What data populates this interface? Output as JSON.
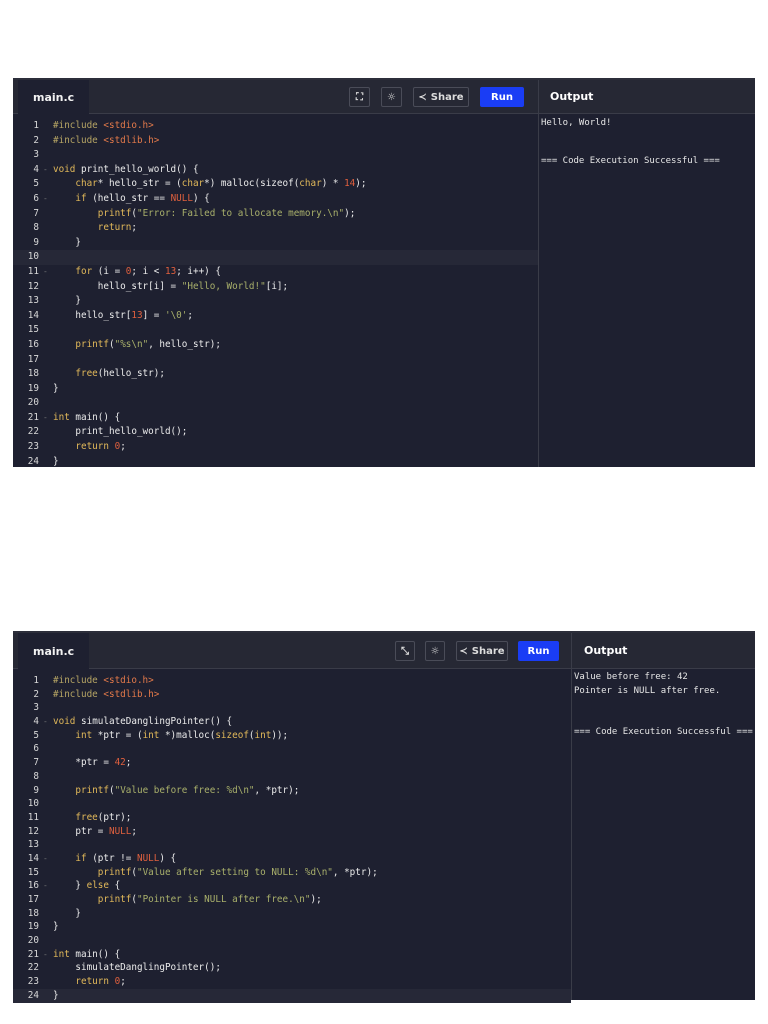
{
  "panels": [
    {
      "tab": "main.c",
      "share_label": "Share",
      "run_label": "Run",
      "output_label": "Output",
      "highlight_line": 10,
      "output": [
        "Hello, World!",
        "",
        "",
        "=== Code Execution Successful ==="
      ],
      "lines": [
        {
          "fold": false,
          "tokens": [
            [
              "p",
              "#include "
            ],
            [
              "h",
              "<stdio.h>"
            ]
          ]
        },
        {
          "fold": false,
          "tokens": [
            [
              "p",
              "#include "
            ],
            [
              "h",
              "<stdlib.h>"
            ]
          ]
        },
        {
          "fold": false,
          "tokens": []
        },
        {
          "fold": true,
          "tokens": [
            [
              "k",
              "void "
            ],
            [
              "t",
              "print_hello_world() {"
            ]
          ]
        },
        {
          "fold": false,
          "tokens": [
            [
              "t",
              "    "
            ],
            [
              "k",
              "char"
            ],
            [
              "t",
              "* hello_str = ("
            ],
            [
              "k",
              "char"
            ],
            [
              "t",
              "*) malloc(sizeof("
            ],
            [
              "k",
              "char"
            ],
            [
              "t",
              ") * "
            ],
            [
              "n",
              "14"
            ],
            [
              "t",
              ");"
            ]
          ]
        },
        {
          "fold": true,
          "tokens": [
            [
              "t",
              "    "
            ],
            [
              "k",
              "if"
            ],
            [
              "t",
              " (hello_str == "
            ],
            [
              "n",
              "NULL"
            ],
            [
              "t",
              ") {"
            ]
          ]
        },
        {
          "fold": false,
          "tokens": [
            [
              "t",
              "        "
            ],
            [
              "k",
              "printf"
            ],
            [
              "t",
              "("
            ],
            [
              "s",
              "\"Error: Failed to allocate memory.\\n\""
            ],
            [
              "t",
              ");"
            ]
          ]
        },
        {
          "fold": false,
          "tokens": [
            [
              "t",
              "        "
            ],
            [
              "k",
              "return"
            ],
            [
              "t",
              ";"
            ]
          ]
        },
        {
          "fold": false,
          "tokens": [
            [
              "t",
              "    }"
            ]
          ]
        },
        {
          "fold": false,
          "tokens": []
        },
        {
          "fold": true,
          "tokens": [
            [
              "t",
              "    "
            ],
            [
              "k",
              "for"
            ],
            [
              "t",
              " (i = "
            ],
            [
              "n",
              "0"
            ],
            [
              "t",
              "; i < "
            ],
            [
              "n",
              "13"
            ],
            [
              "t",
              "; i++) {"
            ]
          ]
        },
        {
          "fold": false,
          "tokens": [
            [
              "t",
              "        hello_str[i] = "
            ],
            [
              "s",
              "\"Hello, World!\""
            ],
            [
              "t",
              "[i];"
            ]
          ]
        },
        {
          "fold": false,
          "tokens": [
            [
              "t",
              "    }"
            ]
          ]
        },
        {
          "fold": false,
          "tokens": [
            [
              "t",
              "    hello_str["
            ],
            [
              "n",
              "13"
            ],
            [
              "t",
              "] = "
            ],
            [
              "s",
              "'\\0'"
            ],
            [
              "t",
              ";"
            ]
          ]
        },
        {
          "fold": false,
          "tokens": []
        },
        {
          "fold": false,
          "tokens": [
            [
              "t",
              "    "
            ],
            [
              "k",
              "printf"
            ],
            [
              "t",
              "("
            ],
            [
              "s",
              "\"%s\\n\""
            ],
            [
              "t",
              ", hello_str);"
            ]
          ]
        },
        {
          "fold": false,
          "tokens": []
        },
        {
          "fold": false,
          "tokens": [
            [
              "t",
              "    "
            ],
            [
              "k",
              "free"
            ],
            [
              "t",
              "(hello_str);"
            ]
          ]
        },
        {
          "fold": false,
          "tokens": [
            [
              "t",
              "}"
            ]
          ]
        },
        {
          "fold": false,
          "tokens": []
        },
        {
          "fold": true,
          "tokens": [
            [
              "k",
              "int "
            ],
            [
              "t",
              "main() {"
            ]
          ]
        },
        {
          "fold": false,
          "tokens": [
            [
              "t",
              "    print_hello_world();"
            ]
          ]
        },
        {
          "fold": false,
          "tokens": [
            [
              "t",
              "    "
            ],
            [
              "k",
              "return "
            ],
            [
              "n",
              "0"
            ],
            [
              "t",
              ";"
            ]
          ]
        },
        {
          "fold": false,
          "tokens": [
            [
              "t",
              "}"
            ]
          ]
        }
      ]
    },
    {
      "tab": "main.c",
      "share_label": "Share",
      "run_label": "Run",
      "output_label": "Output",
      "highlight_line": 24,
      "output": [
        "Value before free: 42",
        "Pointer is NULL after free.",
        "",
        "",
        "=== Code Execution Successful ==="
      ],
      "lines": [
        {
          "fold": false,
          "tokens": [
            [
              "p",
              "#include "
            ],
            [
              "h",
              "<stdio.h>"
            ]
          ]
        },
        {
          "fold": false,
          "tokens": [
            [
              "p",
              "#include "
            ],
            [
              "h",
              "<stdlib.h>"
            ]
          ]
        },
        {
          "fold": false,
          "tokens": []
        },
        {
          "fold": true,
          "tokens": [
            [
              "k",
              "void "
            ],
            [
              "t",
              "simulateDanglingPointer() {"
            ]
          ]
        },
        {
          "fold": false,
          "tokens": [
            [
              "t",
              "    "
            ],
            [
              "k",
              "int "
            ],
            [
              "t",
              "*ptr = ("
            ],
            [
              "k",
              "int "
            ],
            [
              "t",
              "*)malloc("
            ],
            [
              "k",
              "sizeof"
            ],
            [
              "t",
              "("
            ],
            [
              "k",
              "int"
            ],
            [
              "t",
              "));"
            ]
          ]
        },
        {
          "fold": false,
          "tokens": []
        },
        {
          "fold": false,
          "tokens": [
            [
              "t",
              "    *ptr = "
            ],
            [
              "n",
              "42"
            ],
            [
              "t",
              ";"
            ]
          ]
        },
        {
          "fold": false,
          "tokens": []
        },
        {
          "fold": false,
          "tokens": [
            [
              "t",
              "    "
            ],
            [
              "k",
              "printf"
            ],
            [
              "t",
              "("
            ],
            [
              "s",
              "\"Value before free: %d\\n\""
            ],
            [
              "t",
              ", *ptr);"
            ]
          ]
        },
        {
          "fold": false,
          "tokens": []
        },
        {
          "fold": false,
          "tokens": [
            [
              "t",
              "    "
            ],
            [
              "k",
              "free"
            ],
            [
              "t",
              "(ptr);"
            ]
          ]
        },
        {
          "fold": false,
          "tokens": [
            [
              "t",
              "    ptr = "
            ],
            [
              "n",
              "NULL"
            ],
            [
              "t",
              ";"
            ]
          ]
        },
        {
          "fold": false,
          "tokens": []
        },
        {
          "fold": true,
          "tokens": [
            [
              "t",
              "    "
            ],
            [
              "k",
              "if"
            ],
            [
              "t",
              " (ptr != "
            ],
            [
              "n",
              "NULL"
            ],
            [
              "t",
              ") {"
            ]
          ]
        },
        {
          "fold": false,
          "tokens": [
            [
              "t",
              "        "
            ],
            [
              "k",
              "printf"
            ],
            [
              "t",
              "("
            ],
            [
              "s",
              "\"Value after setting to NULL: %d\\n\""
            ],
            [
              "t",
              ", *ptr);"
            ]
          ]
        },
        {
          "fold": true,
          "tokens": [
            [
              "t",
              "    } "
            ],
            [
              "k",
              "else"
            ],
            [
              "t",
              " {"
            ]
          ]
        },
        {
          "fold": false,
          "tokens": [
            [
              "t",
              "        "
            ],
            [
              "k",
              "printf"
            ],
            [
              "t",
              "("
            ],
            [
              "s",
              "\"Pointer is NULL after free.\\n\""
            ],
            [
              "t",
              ");"
            ]
          ]
        },
        {
          "fold": false,
          "tokens": [
            [
              "t",
              "    }"
            ]
          ]
        },
        {
          "fold": false,
          "tokens": [
            [
              "t",
              "}"
            ]
          ]
        },
        {
          "fold": false,
          "tokens": []
        },
        {
          "fold": true,
          "tokens": [
            [
              "k",
              "int "
            ],
            [
              "t",
              "main() {"
            ]
          ]
        },
        {
          "fold": false,
          "tokens": [
            [
              "t",
              "    simulateDanglingPointer();"
            ]
          ]
        },
        {
          "fold": false,
          "tokens": [
            [
              "t",
              "    "
            ],
            [
              "k",
              "return "
            ],
            [
              "n",
              "0"
            ],
            [
              "t",
              ";"
            ]
          ]
        },
        {
          "fold": false,
          "tokens": [
            [
              "t",
              "}"
            ]
          ]
        }
      ]
    }
  ]
}
